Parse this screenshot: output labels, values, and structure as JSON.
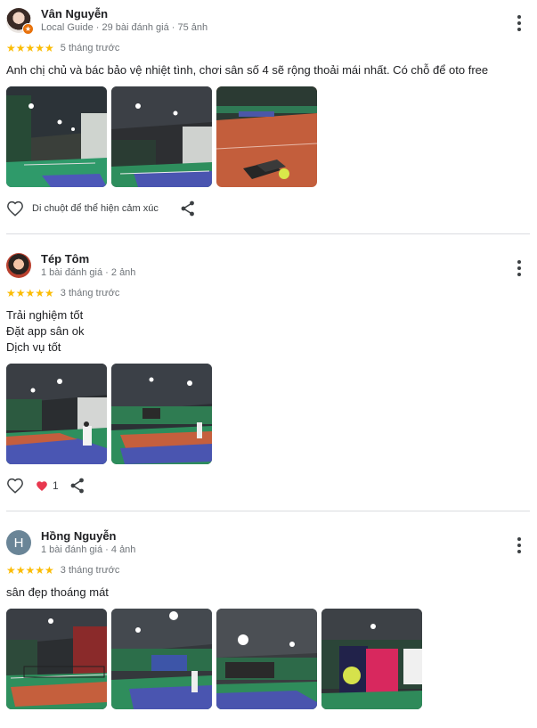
{
  "reviews": [
    {
      "name": "Vân Nguyễn",
      "meta": "Local Guide · 29 bài đánh giá · 75 ảnh",
      "stars": "★★★★★",
      "when": "5 tháng trước",
      "text": "Anh chị chủ và bác bảo vệ nhiệt tình, chơi sân số 4 sẽ rộng thoải mái nhất. Có chỗ để oto free",
      "like_hint": "Di chuột để thể hiện cảm xúc",
      "icons": {
        "like": "heart-outline-icon",
        "share": "share-icon",
        "more": "more-vert-icon",
        "badge": "local-guide-badge-icon"
      }
    },
    {
      "name": "Tép Tôm",
      "meta": "1 bài đánh giá · 2 ảnh",
      "stars": "★★★★★",
      "when": "3 tháng trước",
      "text": "Trải nghiệm tốt\nĐặt app sân ok\nDịch vụ tốt",
      "like_count": "1",
      "icons": {
        "like": "heart-outline-icon",
        "reaction": "heart-filled-icon",
        "share": "share-icon",
        "more": "more-vert-icon"
      }
    },
    {
      "name": "Hồng Nguyễn",
      "avatar_letter": "H",
      "meta": "1 bài đánh giá · 4 ảnh",
      "stars": "★★★★★",
      "when": "3 tháng trước",
      "text": "sân đẹp thoáng mát",
      "icons": {
        "more": "more-vert-icon"
      }
    }
  ],
  "colors": {
    "star": "#fbbc04",
    "meta": "#70757a",
    "reaction": "#e8384f",
    "divider": "#dadce0"
  }
}
